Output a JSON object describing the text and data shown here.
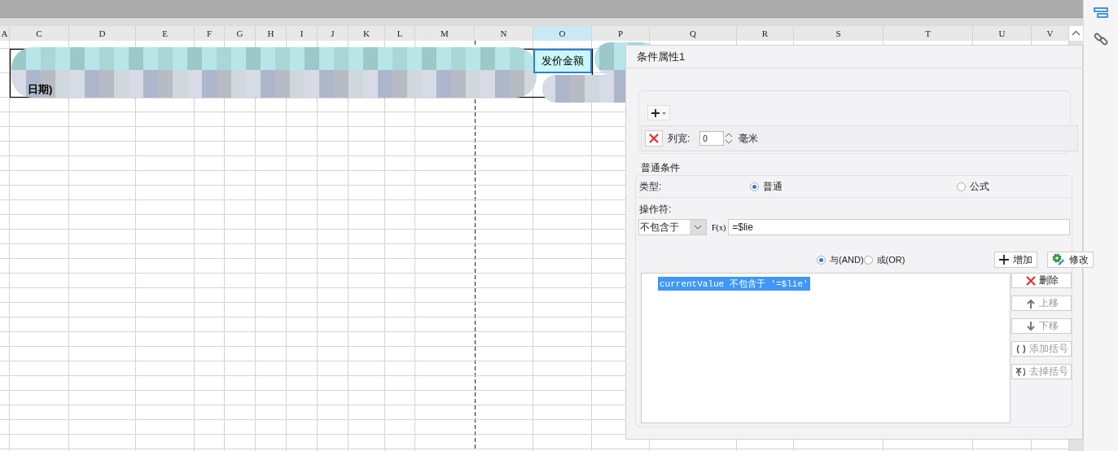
{
  "sheet": {
    "columns": [
      {
        "label": "A",
        "selected": false
      },
      {
        "label": "C",
        "selected": false
      },
      {
        "label": "D",
        "selected": false
      },
      {
        "label": "E",
        "selected": false
      },
      {
        "label": "F",
        "selected": false
      },
      {
        "label": "G",
        "selected": false
      },
      {
        "label": "H",
        "selected": false
      },
      {
        "label": "I",
        "selected": false
      },
      {
        "label": "J",
        "selected": false
      },
      {
        "label": "K",
        "selected": false
      },
      {
        "label": "L",
        "selected": false
      },
      {
        "label": "M",
        "selected": false
      },
      {
        "label": "N",
        "selected": false
      },
      {
        "label": "O",
        "selected": true
      },
      {
        "label": "P",
        "selected": false
      },
      {
        "label": "Q",
        "selected": false
      },
      {
        "label": "R",
        "selected": false
      },
      {
        "label": "S",
        "selected": false
      },
      {
        "label": "T",
        "selected": false
      },
      {
        "label": "U",
        "selected": false
      },
      {
        "label": "V",
        "selected": false
      }
    ],
    "cells": [
      {
        "text": "发价金额",
        "kind": "selected"
      },
      {
        "text": "日期)",
        "kind": "bold"
      }
    ]
  },
  "panel": {
    "title": "条件属性1",
    "column_width": {
      "label": "列宽:",
      "value": "0",
      "unit": "毫米"
    },
    "group_title": "普通条件",
    "type": {
      "label": "类型:",
      "options": [
        {
          "label": "普通",
          "selected": true
        },
        {
          "label": "公式",
          "selected": false
        }
      ]
    },
    "operator": {
      "label": "操作符:",
      "value": "不包含于",
      "formula_button": "F(x)",
      "formula_value": "=$lie"
    },
    "joins": [
      {
        "label": "与(AND)",
        "selected": true
      },
      {
        "label": "或(OR)",
        "selected": false
      }
    ],
    "actions": [
      {
        "label": "增加",
        "kind": "add"
      },
      {
        "label": "修改",
        "kind": "edit"
      }
    ],
    "conditions": [
      {
        "text": "currentValue 不包含于 '=$lie'",
        "selected": true
      }
    ],
    "list_actions": [
      {
        "label": "删除",
        "kind": "delete",
        "disabled": false
      },
      {
        "label": "上移",
        "kind": "up",
        "disabled": true
      },
      {
        "label": "下移",
        "kind": "down",
        "disabled": true
      },
      {
        "label": "添加括号",
        "kind": "paren-add",
        "disabled": true
      },
      {
        "label": "去掉括号",
        "kind": "paren-remove",
        "disabled": true
      }
    ]
  },
  "sidebar": [
    {
      "kind": "properties",
      "selected": true
    },
    {
      "kind": "link",
      "selected": false
    }
  ]
}
